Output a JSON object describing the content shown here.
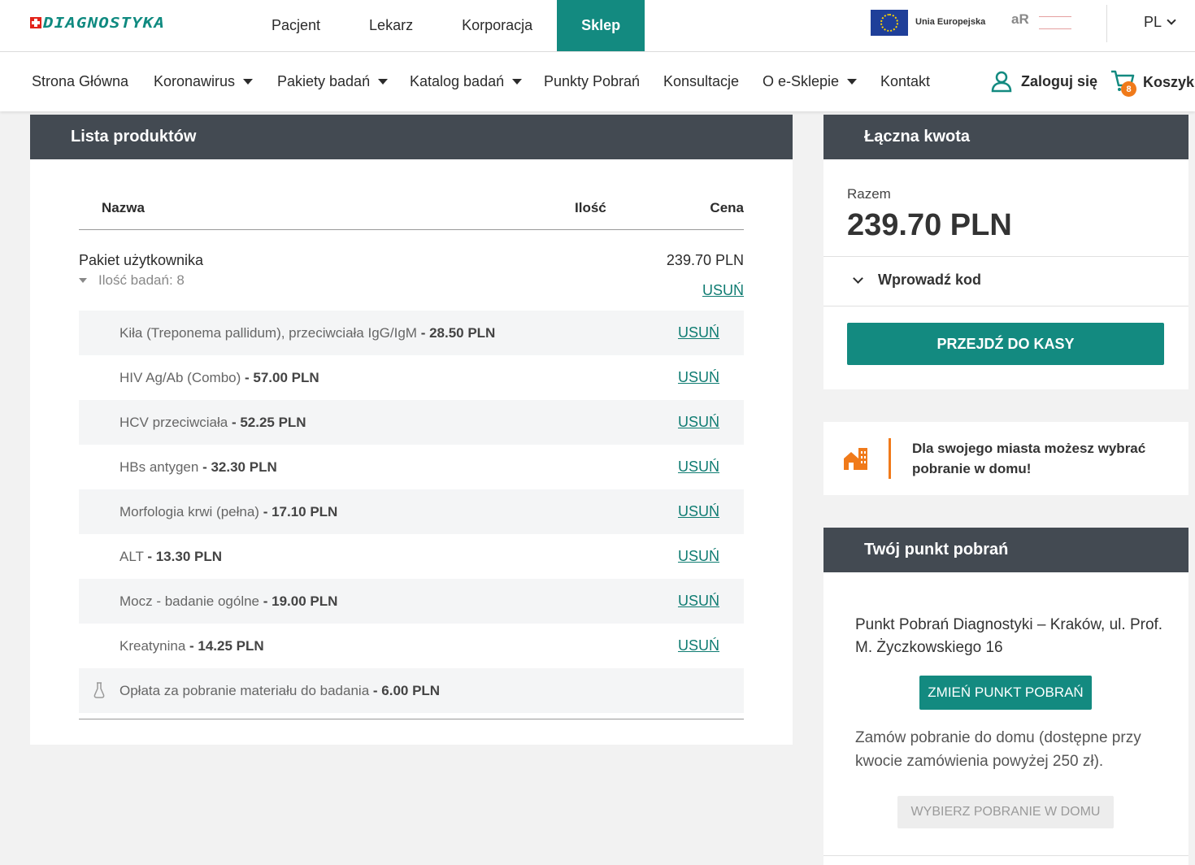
{
  "brand": {
    "logo_text": "DIAGNOSTYKA"
  },
  "top_nav": {
    "tabs": [
      "Pacjent",
      "Lekarz",
      "Korporacja",
      "Sklep"
    ],
    "active": "Sklep",
    "eu_label": "Unia Europejska",
    "ar_logo": "aR",
    "language": "PL"
  },
  "main_nav": {
    "items": [
      "Strona Główna",
      "Koronawirus",
      "Pakiety badań",
      "Katalog badań",
      "Punkty Pobrań",
      "Konsultacje",
      "O e-Sklepie",
      "Kontakt"
    ],
    "login": "Zaloguj się",
    "cart": "Koszyk",
    "cart_count": "8"
  },
  "product_list": {
    "title": "Lista produktów",
    "columns": {
      "name": "Nazwa",
      "qty": "Ilość",
      "price": "Cena"
    },
    "package": {
      "name": "Pakiet użytkownika",
      "price": "239.70 PLN",
      "count_label": "Ilość badań: 8",
      "remove": "USUŃ"
    },
    "items": [
      {
        "name": "Kiła (Treponema pallidum), przeciwciała IgG/IgM",
        "price": "- 28.50 PLN",
        "remove": "USUŃ"
      },
      {
        "name": "HIV Ag/Ab (Combo)",
        "price": "- 57.00 PLN",
        "remove": "USUŃ"
      },
      {
        "name": "HCV przeciwciała",
        "price": "- 52.25 PLN",
        "remove": "USUŃ"
      },
      {
        "name": "HBs antygen",
        "price": "- 32.30 PLN",
        "remove": "USUŃ"
      },
      {
        "name": "Morfologia krwi (pełna)",
        "price": "- 17.10 PLN",
        "remove": "USUŃ"
      },
      {
        "name": "ALT",
        "price": "- 13.30 PLN",
        "remove": "USUŃ"
      },
      {
        "name": "Mocz - badanie ogólne",
        "price": "- 19.00 PLN",
        "remove": "USUŃ"
      },
      {
        "name": "Kreatynina",
        "price": "- 14.25 PLN",
        "remove": "USUŃ"
      }
    ],
    "fee": {
      "name": "Opłata za pobranie materiału do badania",
      "price": "- 6.00 PLN"
    }
  },
  "summary": {
    "title": "Łączna kwota",
    "total_label": "Razem",
    "total_value": "239.70 PLN",
    "code_label": "Wprowadź kod",
    "checkout": "PRZEJDŹ DO KASY"
  },
  "info": {
    "text": "Dla swojego miasta możesz wybrać pobranie w domu!"
  },
  "collection_point": {
    "title": "Twój punkt pobrań",
    "address": "Punkt Pobrań Diagnostyki – Kraków, ul. Prof. M. Życzkowskiego 16",
    "change_button": "ZMIEŃ PUNKT POBRAŃ",
    "home_text": "Zamów pobranie do domu (dostępne przy kwocie zamówienia powyżej 250 zł).",
    "home_button": "WYBIERZ POBRANIE W DOMU"
  },
  "colors": {
    "accent": "#138a80",
    "header": "#434a52",
    "orange": "#f07a1a"
  }
}
